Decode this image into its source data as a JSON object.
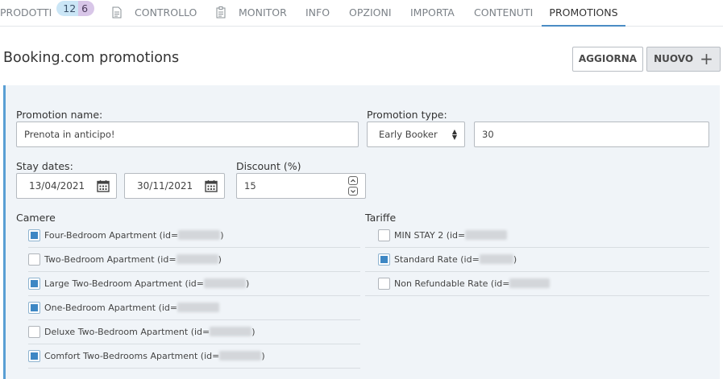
{
  "nav": {
    "items": [
      {
        "label": "PRODOTTI"
      },
      {
        "label": "CONTROLLO"
      },
      {
        "label": "MONITOR"
      },
      {
        "label": "INFO"
      },
      {
        "label": "OPZIONI"
      },
      {
        "label": "IMPORTA"
      },
      {
        "label": "CONTENUTI"
      },
      {
        "label": "PROMOTIONS"
      }
    ],
    "badge_a": "12",
    "badge_b": "6",
    "active_color": "#4a8cc4"
  },
  "header": {
    "title": "Booking.com promotions",
    "refresh_label": "AGGIORNA",
    "new_label": "NUOVO",
    "new_icon": "plus-icon"
  },
  "form": {
    "promotion_name_label": "Promotion name:",
    "promotion_name_value": "Prenota in anticipo!",
    "promotion_type_label": "Promotion type:",
    "promotion_type_value": "Early Booker",
    "promotion_type_extra": "30",
    "stay_dates_label": "Stay dates:",
    "date_from": "13/04/2021",
    "date_to": "30/11/2021",
    "discount_label": "Discount (%)",
    "discount_value": "15"
  },
  "camere": {
    "title": "Camere",
    "items": [
      {
        "label": "Four-Bedroom Apartment (id=",
        "suffix": ")",
        "checked": true
      },
      {
        "label": "Two-Bedroom Apartment (id=",
        "suffix": ")",
        "checked": false
      },
      {
        "label": "Large Two-Bedroom Apartment (id=",
        "suffix": ")",
        "checked": true
      },
      {
        "label": "One-Bedroom Apartment (id=",
        "suffix": "",
        "checked": true
      },
      {
        "label": "Deluxe Two-Bedroom Apartment (id=",
        "suffix": ")",
        "checked": false
      },
      {
        "label": "Comfort Two-Bedrooms Apartment (id=",
        "suffix": ")",
        "checked": true
      }
    ]
  },
  "tariffe": {
    "title": "Tariffe",
    "items": [
      {
        "label": "MIN STAY 2 (id=",
        "suffix": "",
        "checked": false
      },
      {
        "label": "Standard Rate (id=",
        "suffix": ")",
        "checked": true
      },
      {
        "label": "Non Refundable Rate (id=",
        "suffix": "",
        "checked": false
      }
    ]
  },
  "colors": {
    "accent": "#3d87c4",
    "panel_bg": "#f0f4f8"
  }
}
